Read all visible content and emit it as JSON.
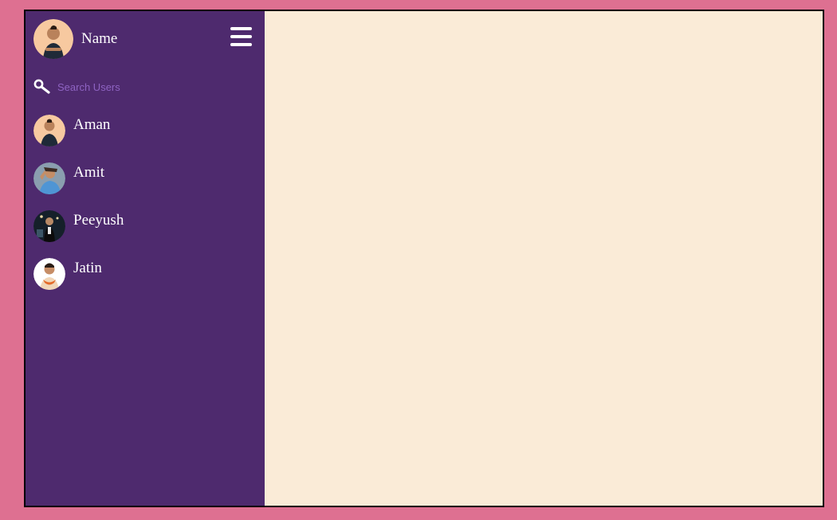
{
  "profile": {
    "name": "Name"
  },
  "search": {
    "placeholder": "Search Users"
  },
  "users": [
    {
      "name": "Aman"
    },
    {
      "name": "Amit"
    },
    {
      "name": "Peeyush"
    },
    {
      "name": "Jatin"
    }
  ],
  "colors": {
    "page_background": "#de7091",
    "sidebar_background": "#4e2a6e",
    "main_background": "#faebd7",
    "search_placeholder": "#8e63c2",
    "text": "#ffffff"
  }
}
